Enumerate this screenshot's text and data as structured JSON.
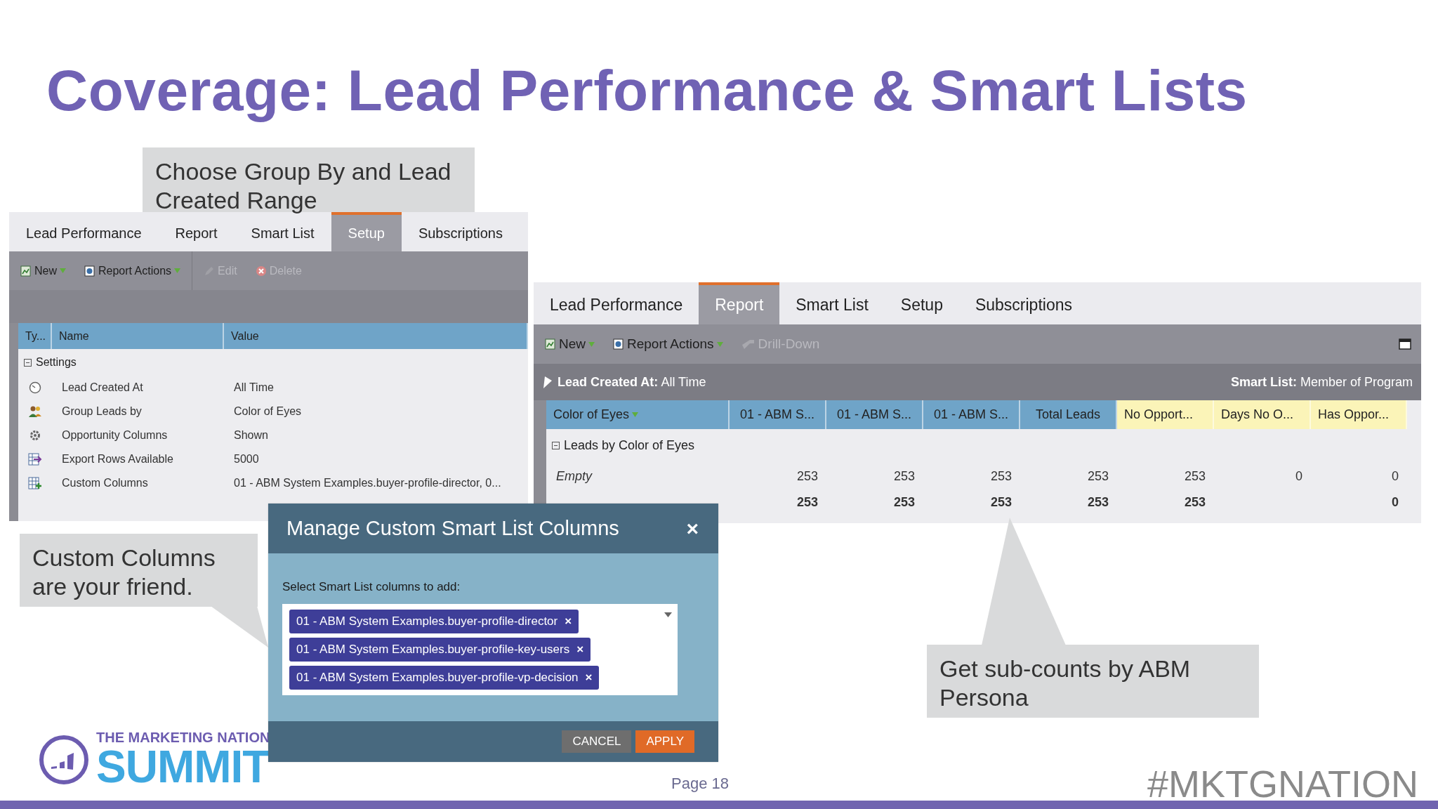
{
  "slide_title": "Coverage: Lead Performance & Smart Lists",
  "callouts": [
    {
      "text": "Choose Group By and Lead Created Range"
    },
    {
      "text": "Custom Columns are your friend."
    },
    {
      "text": "Get sub-counts by ABM Persona"
    }
  ],
  "setup_panel": {
    "tabs": [
      {
        "label": "Lead Performance",
        "selected": false
      },
      {
        "label": "Report",
        "selected": false
      },
      {
        "label": "Smart List",
        "selected": false
      },
      {
        "label": "Setup",
        "selected": true
      },
      {
        "label": "Subscriptions",
        "selected": false
      }
    ],
    "toolbar": [
      {
        "label": "New",
        "menu": true,
        "disabled": false
      },
      {
        "label": "Report Actions",
        "menu": true,
        "disabled": false
      },
      {
        "label": "Edit",
        "menu": false,
        "disabled": true
      },
      {
        "label": "Delete",
        "menu": false,
        "disabled": true
      }
    ],
    "columns": [
      "Ty...",
      "Name",
      "Value"
    ],
    "group": {
      "label": "Settings",
      "expanded": true
    },
    "rows": [
      {
        "name": "Lead Created At",
        "value": "All Time"
      },
      {
        "name": "Group Leads by",
        "value": "Color of Eyes"
      },
      {
        "name": "Opportunity Columns",
        "value": "Shown"
      },
      {
        "name": "Export Rows Available",
        "value": "5000"
      },
      {
        "name": "Custom Columns",
        "value": "01 - ABM System Examples.buyer-profile-director, 0..."
      }
    ]
  },
  "report_panel": {
    "tabs": [
      {
        "label": "Lead Performance",
        "selected": false
      },
      {
        "label": "Report",
        "selected": true
      },
      {
        "label": "Smart List",
        "selected": false
      },
      {
        "label": "Setup",
        "selected": false
      },
      {
        "label": "Subscriptions",
        "selected": false
      }
    ],
    "toolbar": [
      {
        "label": "New",
        "menu": true,
        "disabled": false
      },
      {
        "label": "Report Actions",
        "menu": true,
        "disabled": false
      },
      {
        "label": "Drill-Down",
        "menu": false,
        "disabled": true
      }
    ],
    "filter": {
      "label": "Lead Created At:",
      "value": "All Time"
    },
    "smart_list": {
      "label": "Smart List:",
      "value": "Member of Program"
    },
    "columns": [
      {
        "label": "Color of Eyes",
        "menu": true,
        "highlight": false
      },
      {
        "label": "01 - ABM S...",
        "menu": false,
        "highlight": false
      },
      {
        "label": "01 - ABM S...",
        "menu": false,
        "highlight": false
      },
      {
        "label": "01 - ABM S...",
        "menu": false,
        "highlight": false
      },
      {
        "label": "Total Leads",
        "menu": false,
        "highlight": false
      },
      {
        "label": "No Opport...",
        "menu": false,
        "highlight": true
      },
      {
        "label": "Days No O...",
        "menu": false,
        "highlight": true
      },
      {
        "label": "Has Oppor...",
        "menu": false,
        "highlight": true
      }
    ],
    "group": {
      "label": "Leads by Color of Eyes",
      "expanded": true
    },
    "rows": [
      {
        "cells": [
          "Empty",
          "253",
          "253",
          "253",
          "253",
          "253",
          "0",
          "0"
        ]
      }
    ],
    "total": {
      "cells": [
        null,
        "253",
        "253",
        "253",
        "253",
        "253",
        null,
        "0"
      ]
    }
  },
  "dialog": {
    "title": "Manage Custom Smart List Columns",
    "close": "×",
    "prompt": "Select Smart List columns to add:",
    "tags": [
      "01 - ABM System Examples.buyer-profile-director",
      "01 - ABM System Examples.buyer-profile-key-users",
      "01 - ABM System Examples.buyer-profile-vp-decision"
    ],
    "tag_remove": "×",
    "buttons": [
      {
        "label": "CANCEL",
        "kind": "secondary"
      },
      {
        "label": "APPLY",
        "kind": "primary"
      }
    ]
  },
  "logo": {
    "tagline": "THE MARKETING NATION",
    "wordmark": "SUMMIT"
  },
  "page_label": "Page 18",
  "hashtag": "#MKTGNATION"
}
